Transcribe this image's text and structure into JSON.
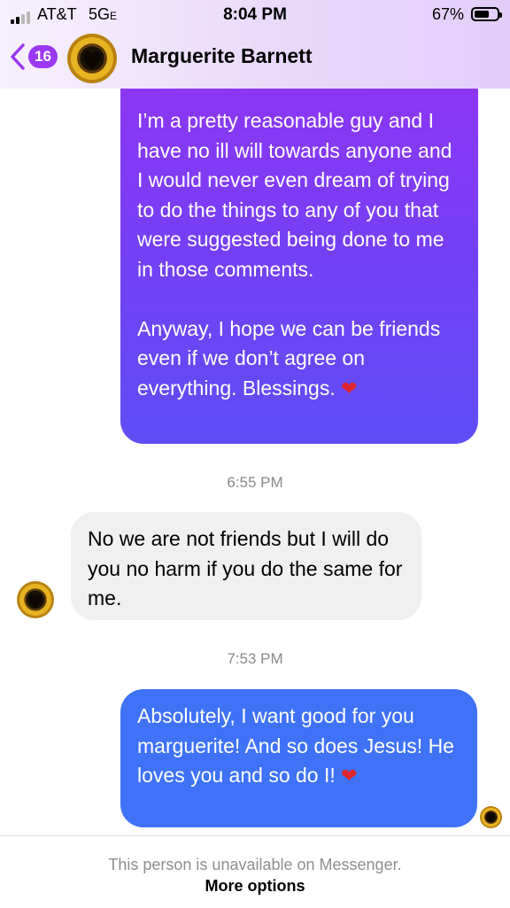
{
  "status_bar": {
    "carrier": "AT&T",
    "network": "5G",
    "network_suffix": "E",
    "time": "8:04 PM",
    "battery_percent_label": "67%",
    "battery_level": 0.67
  },
  "header": {
    "unread_count": "16",
    "contact_name": "Marguerite Barnett"
  },
  "messages": [
    {
      "direction": "outgoing",
      "paragraphs": [
        "I’m a pretty reasonable guy and I have no ill will towards anyone and I would never even dream of trying to do the things to any of you that were suggested being done to me in those comments.",
        "Anyway, I hope we can be friends even if we don’t agree on everything. Blessings. "
      ],
      "emoji": "❤"
    },
    {
      "timestamp": "6:55 PM"
    },
    {
      "direction": "incoming",
      "text": "No we are not friends but I will do you no harm if you do the same for me."
    },
    {
      "timestamp": "7:53 PM"
    },
    {
      "direction": "outgoing",
      "text": "Absolutely, I want good for you marguerite!  And so does Jesus!  He loves you and so do I! ",
      "emoji": "❤"
    }
  ],
  "footer": {
    "unavailable_text": "This person is unavailable on Messenger.",
    "more_options_label": "More options"
  },
  "colors": {
    "outgoing_gradient_top": "#8e36f4",
    "outgoing_gradient_bottom": "#5f4ef5",
    "outgoing_latest": "#3f72f7",
    "incoming": "#f0f0f0",
    "badge": "#9b38f2"
  },
  "icons": {
    "back": "chevron-left-icon",
    "signal": "cell-signal-icon",
    "battery": "battery-icon",
    "avatar": "sunflower-heart-avatar"
  }
}
